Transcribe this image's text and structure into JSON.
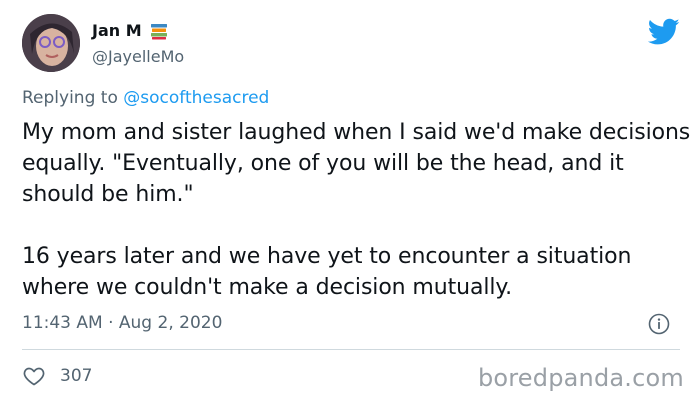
{
  "author": {
    "display_name": "Jan M",
    "handle": "@JayelleMo"
  },
  "reply": {
    "prefix": "Replying to",
    "mention": "@socofthesacred"
  },
  "tweet": {
    "text": "My mom and sister laughed when I said we'd make decisions equally. \"Eventually, one of you will be the head, and it should be him.\"\n\n16 years later and we have yet to encounter a situation where we couldn't make a decision mutually.",
    "timestamp": "11:43 AM · Aug 2, 2020"
  },
  "stats": {
    "likes": "307"
  },
  "watermark": "boredpanda.com",
  "icons": {
    "brand": "twitter-bird-icon",
    "name_emoji": "books-icon",
    "info": "info-icon",
    "like": "heart-icon"
  },
  "colors": {
    "twitter_blue": "#1d9bf0",
    "secondary_text": "#536471",
    "primary_text": "#0f1419"
  }
}
